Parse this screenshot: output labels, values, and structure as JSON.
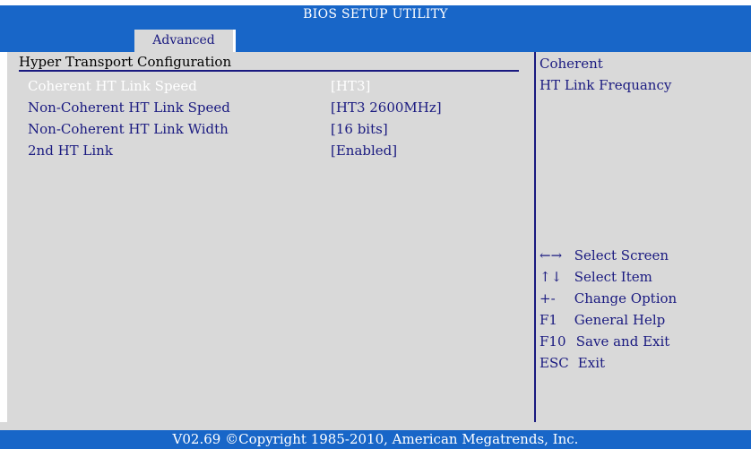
{
  "header": {
    "title": "BIOS SETUP UTILITY",
    "tabs": [
      {
        "label": "Advanced",
        "active": true
      }
    ]
  },
  "section": {
    "title": "Hyper Transport Configuration"
  },
  "settings": [
    {
      "label": "Coherent HT Link Speed",
      "value": "[HT3]",
      "selected": true
    },
    {
      "label": "Non-Coherent HT Link Speed",
      "value": "[HT3 2600MHz]",
      "selected": false
    },
    {
      "label": "Non-Coherent HT Link Width",
      "value": "[16 bits]",
      "selected": false
    },
    {
      "label": "2nd HT Link",
      "value": "[Enabled]",
      "selected": false
    }
  ],
  "help": {
    "line1": "Coherent",
    "line2": "HT Link Frequancy"
  },
  "keys": [
    {
      "key": "←→",
      "action": "Select Screen"
    },
    {
      "key": "↑↓",
      "action": "Select Item"
    },
    {
      "key": "+-",
      "action": "Change Option"
    },
    {
      "key": "F1",
      "action": "General Help"
    },
    {
      "key": "F10",
      "action": "Save and Exit"
    },
    {
      "key": "ESC",
      "action": "Exit"
    }
  ],
  "footer": {
    "text": "V02.69 ©Copyright 1985-2010, American Megatrends, Inc."
  },
  "colors": {
    "header_blue": "#1866c8",
    "panel_gray": "#d9d9d9",
    "text_navy": "#1a1a80",
    "selected_text": "#ffffff"
  }
}
